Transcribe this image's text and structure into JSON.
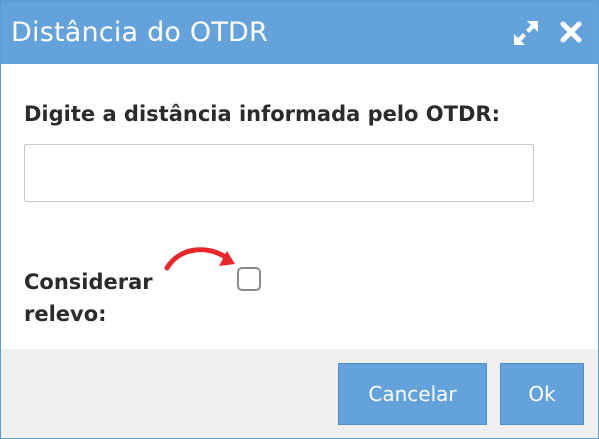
{
  "dialog": {
    "title": "Distância do OTDR",
    "icons": {
      "maximize": "expand-arrows-icon",
      "close": "close-x-icon"
    }
  },
  "form": {
    "distance_label": "Digite a distância informada pelo OTDR:",
    "distance_value": "",
    "distance_placeholder": "",
    "relief_label": "Considerar relevo:",
    "relief_checked": false,
    "annotation_arrow_color": "#e8262a"
  },
  "footer": {
    "cancel_label": "Cancelar",
    "ok_label": "Ok"
  },
  "colors": {
    "accent": "#63a2db",
    "footer_bg": "#efefef",
    "text": "#2b2b2b"
  }
}
